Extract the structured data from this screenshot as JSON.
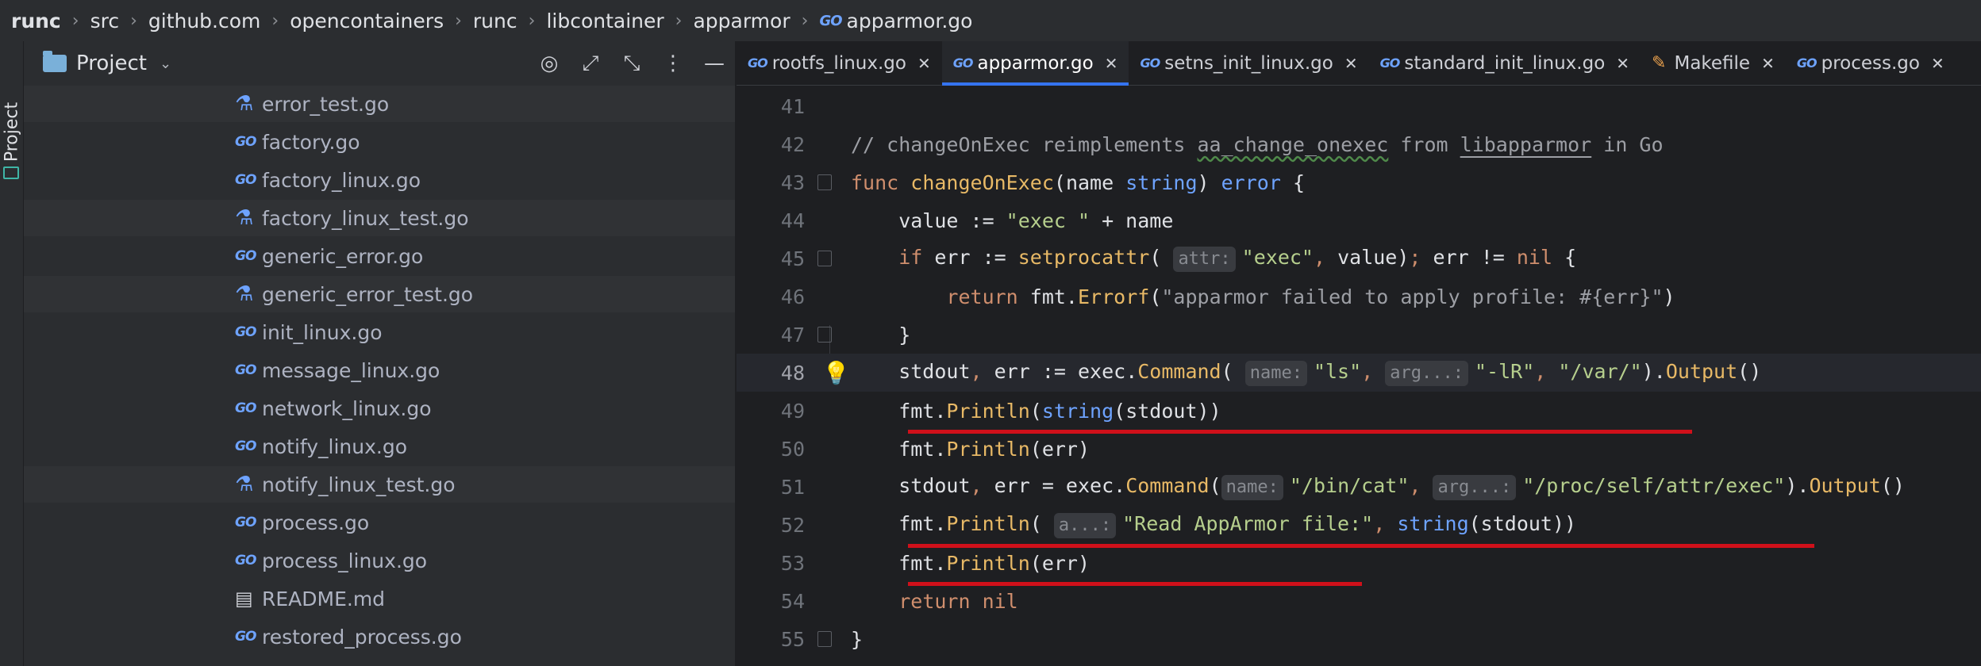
{
  "breadcrumb": {
    "items": [
      "runc",
      "src",
      "github.com",
      "opencontainers",
      "runc",
      "libcontainer",
      "apparmor"
    ],
    "current": "apparmor.go",
    "file_icon": "go-file-icon"
  },
  "toolstrip": {
    "project_label": "Project"
  },
  "project_panel": {
    "title": "Project",
    "files": [
      {
        "name": "error_test.go",
        "icon": "go-test",
        "shaded": true
      },
      {
        "name": "factory.go",
        "icon": "go",
        "shaded": false
      },
      {
        "name": "factory_linux.go",
        "icon": "go",
        "shaded": false
      },
      {
        "name": "factory_linux_test.go",
        "icon": "go-test",
        "shaded": true
      },
      {
        "name": "generic_error.go",
        "icon": "go",
        "shaded": false
      },
      {
        "name": "generic_error_test.go",
        "icon": "go-test",
        "shaded": true
      },
      {
        "name": "init_linux.go",
        "icon": "go",
        "shaded": false
      },
      {
        "name": "message_linux.go",
        "icon": "go",
        "shaded": false
      },
      {
        "name": "network_linux.go",
        "icon": "go",
        "shaded": false
      },
      {
        "name": "notify_linux.go",
        "icon": "go",
        "shaded": false
      },
      {
        "name": "notify_linux_test.go",
        "icon": "go-test",
        "shaded": true
      },
      {
        "name": "process.go",
        "icon": "go",
        "shaded": false
      },
      {
        "name": "process_linux.go",
        "icon": "go",
        "shaded": false
      },
      {
        "name": "README.md",
        "icon": "markdown",
        "shaded": false
      },
      {
        "name": "restored_process.go",
        "icon": "go",
        "shaded": false
      }
    ]
  },
  "tabs": [
    {
      "label": "rootfs_linux.go",
      "icon": "go",
      "active": false
    },
    {
      "label": "apparmor.go",
      "icon": "go",
      "active": true
    },
    {
      "label": "setns_init_linux.go",
      "icon": "go",
      "active": false
    },
    {
      "label": "standard_init_linux.go",
      "icon": "go",
      "active": false
    },
    {
      "label": "Makefile",
      "icon": "makefile",
      "active": false
    },
    {
      "label": "process.go",
      "icon": "go",
      "active": false
    }
  ],
  "go_icon_text": "GO",
  "close_glyph": "✕",
  "code": {
    "current_line": 48,
    "line_numbers": [
      "41",
      "42",
      "43",
      "44",
      "45",
      "46",
      "47",
      "48",
      "49",
      "50",
      "51",
      "52",
      "53",
      "54",
      "55"
    ]
  },
  "colors": {
    "accent": "#3574f0",
    "underline": "#d0101a",
    "keyword": "#cf8e6d",
    "function": "#e8b966",
    "string": "#b6cf8d",
    "type": "#6ea3ff"
  }
}
